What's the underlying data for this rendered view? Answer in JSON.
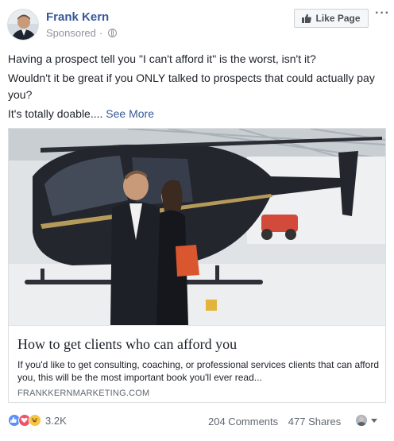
{
  "post": {
    "author": "Frank Kern",
    "meta": "Sponsored",
    "meta_sep": "·",
    "icons": {
      "avatar": "profile-photo",
      "audience": "globe-icon",
      "more": "more-horizontal-icon",
      "like": "thumbs-up-icon"
    },
    "like_page_label": "Like Page",
    "more_label": "···",
    "paragraphs": [
      "Having a prospect tell you \"I can't afford it\" is the worst, isn't it?",
      "Wouldn't it be great if you ONLY talked to prospects that could actually pay you?"
    ],
    "last_line": "It's totally doable....",
    "see_more": "See More"
  },
  "link_card": {
    "image": "photo-helicopter-hangar",
    "title": "How to get clients who can afford you",
    "description": "If you'd like to get consulting, coaching, or professional services clients that can afford you, this will be the most important book you'll ever read...",
    "domain": "FRANKKERNMARKETING.COM"
  },
  "footer": {
    "reactions": [
      "like",
      "love",
      "haha"
    ],
    "reaction_count": "3.2K",
    "comments": "204 Comments",
    "shares": "477 Shares"
  },
  "colors": {
    "link": "#365899",
    "text": "#1d2129",
    "meta": "#90949c",
    "like": "#5890ff",
    "love": "#f25268",
    "haha": "#f7c543"
  }
}
